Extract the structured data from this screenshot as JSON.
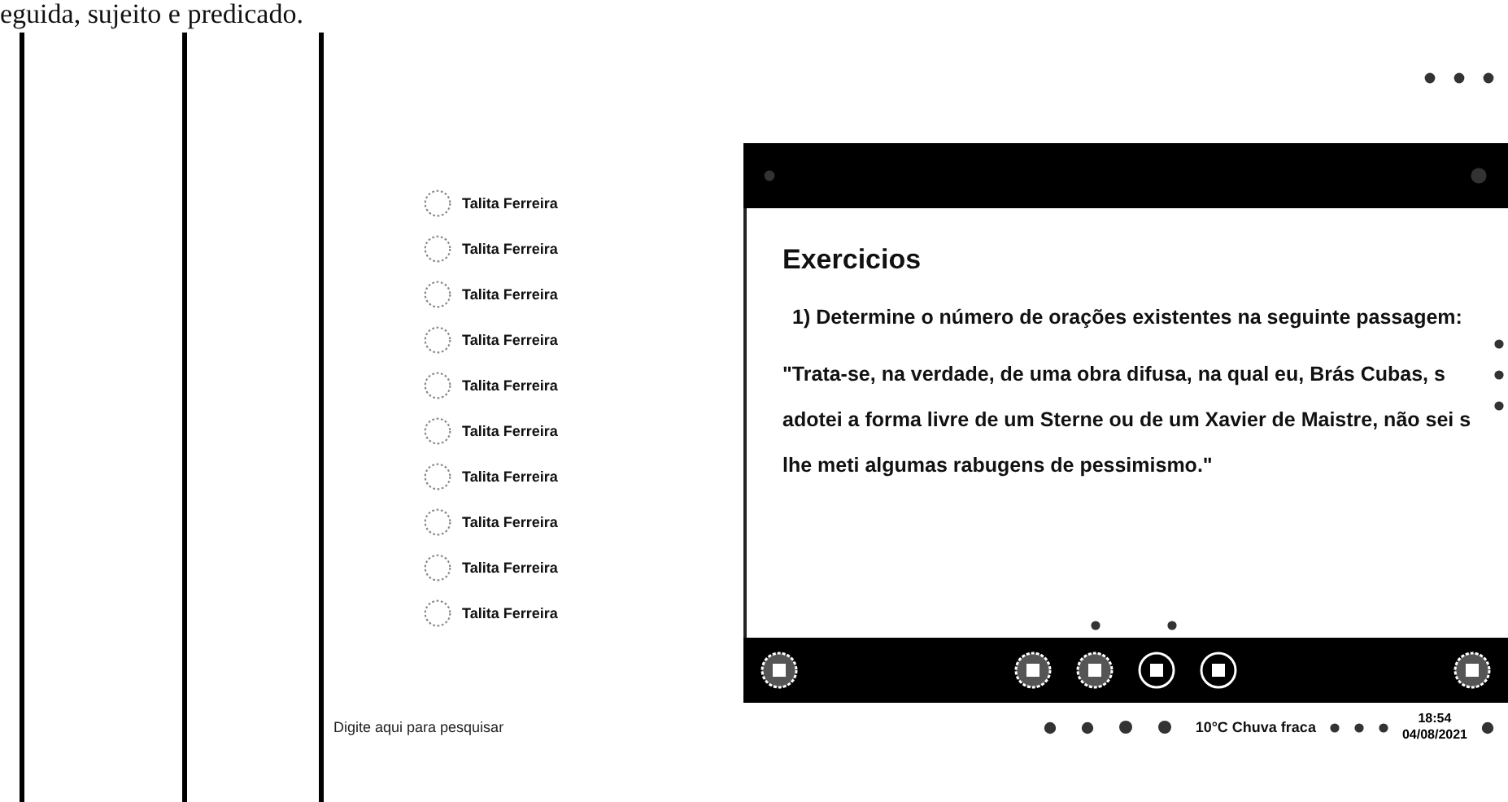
{
  "document": {
    "text_line": "eguida, sujeito e predicado."
  },
  "contacts": [
    {
      "name": "Talita Ferreira"
    },
    {
      "name": "Talita Ferreira"
    },
    {
      "name": "Talita Ferreira"
    },
    {
      "name": "Talita Ferreira"
    },
    {
      "name": "Talita Ferreira"
    },
    {
      "name": "Talita Ferreira"
    },
    {
      "name": "Talita Ferreira"
    },
    {
      "name": "Talita Ferreira"
    },
    {
      "name": "Talita Ferreira"
    },
    {
      "name": "Talita Ferreira"
    }
  ],
  "lesson": {
    "title": "Exercicios",
    "question": "1) Determine o número de orações existentes na seguinte passagem:",
    "quote_lines": [
      "\"Trata-se, na verdade, de uma obra difusa, na qual eu, Brás Cubas, s",
      "adotei a forma livre de um Sterne ou de um Xavier de Maistre, não sei s",
      "lhe meti algumas rabugens de pessimismo.\""
    ]
  },
  "taskbar": {
    "search_placeholder": "Digite aqui para pesquisar",
    "weather": "10°C Chuva fraca",
    "time": "18:54",
    "date": "04/08/2021"
  }
}
